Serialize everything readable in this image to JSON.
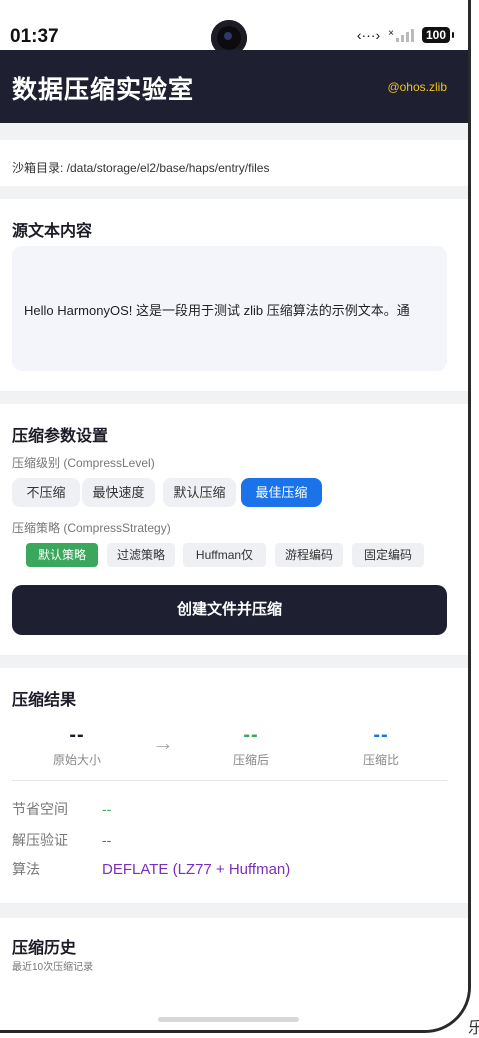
{
  "status_bar": {
    "time": "01:37",
    "signal_label": "×",
    "battery": "100"
  },
  "header": {
    "title": "数据压缩实验室",
    "tag": "@ohos.zlib"
  },
  "sandbox": {
    "text": "沙箱目录: /data/storage/el2/base/haps/entry/files"
  },
  "source": {
    "title": "源文本内容",
    "text": "Hello HarmonyOS! 这是一段用于测试 zlib 压缩算法的示例文本。通"
  },
  "params": {
    "title": "压缩参数设置",
    "level_label": "压缩级别 (CompressLevel)",
    "levels": [
      "不压缩",
      "最快速度",
      "默认压缩",
      "最佳压缩"
    ],
    "selected_level": "最佳压缩",
    "strategy_label": "压缩策略 (CompressStrategy)",
    "strategies": [
      "默认策略",
      "过滤策略",
      "Huffman仅",
      "游程编码",
      "固定编码"
    ],
    "selected_strategy": "默认策略",
    "action_button": "创建文件并压缩"
  },
  "result": {
    "title": "压缩结果",
    "original_value": "--",
    "original_label": "原始大小",
    "compressed_value": "--",
    "compressed_label": "压缩后",
    "ratio_value": "--",
    "ratio_label": "压缩比",
    "saved_label": "节省空间",
    "saved_value": "--",
    "verify_label": "解压验证",
    "verify_value": "--",
    "algo_label": "算法",
    "algo_value": "DEFLATE (LZ77 + Huffman)"
  },
  "history": {
    "title": "压缩历史",
    "desc": "最近10次压缩记录"
  },
  "edge_text": "乐",
  "colors": {
    "header_bg": "#1e1f30",
    "accent_blue": "#1a73e8",
    "accent_green": "#3aa75d",
    "accent_purple": "#7b2fbe",
    "tag_yellow": "#f0c419"
  }
}
